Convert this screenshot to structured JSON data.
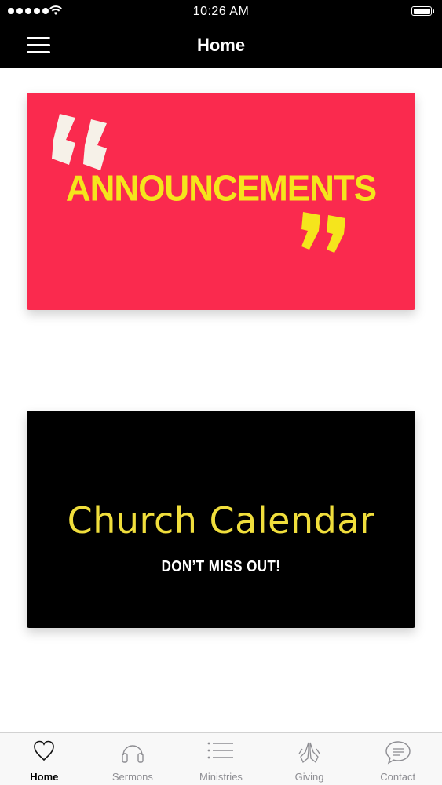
{
  "status_bar": {
    "time": "10:26 AM"
  },
  "nav": {
    "title": "Home"
  },
  "cards": {
    "announcements": {
      "heading": "ANNOUNCEMENTS",
      "quote_open": "“",
      "quote_close": "”"
    },
    "calendar": {
      "heading": "Church Calendar",
      "subheading": "DON’T MISS OUT!"
    }
  },
  "tabs": [
    {
      "label": "Home",
      "icon": "heart-icon",
      "active": true
    },
    {
      "label": "Sermons",
      "icon": "headphones-icon",
      "active": false
    },
    {
      "label": "Ministries",
      "icon": "list-icon",
      "active": false
    },
    {
      "label": "Giving",
      "icon": "praying-hands-icon",
      "active": false
    },
    {
      "label": "Contact",
      "icon": "chat-bubble-icon",
      "active": false
    }
  ],
  "colors": {
    "announcement_bg": "#fa2a4e",
    "announcement_text": "#f5e51c",
    "calendar_bg": "#000000",
    "calendar_text": "#f0de3c",
    "tab_active": "#000000",
    "tab_inactive": "#8e8e93"
  }
}
